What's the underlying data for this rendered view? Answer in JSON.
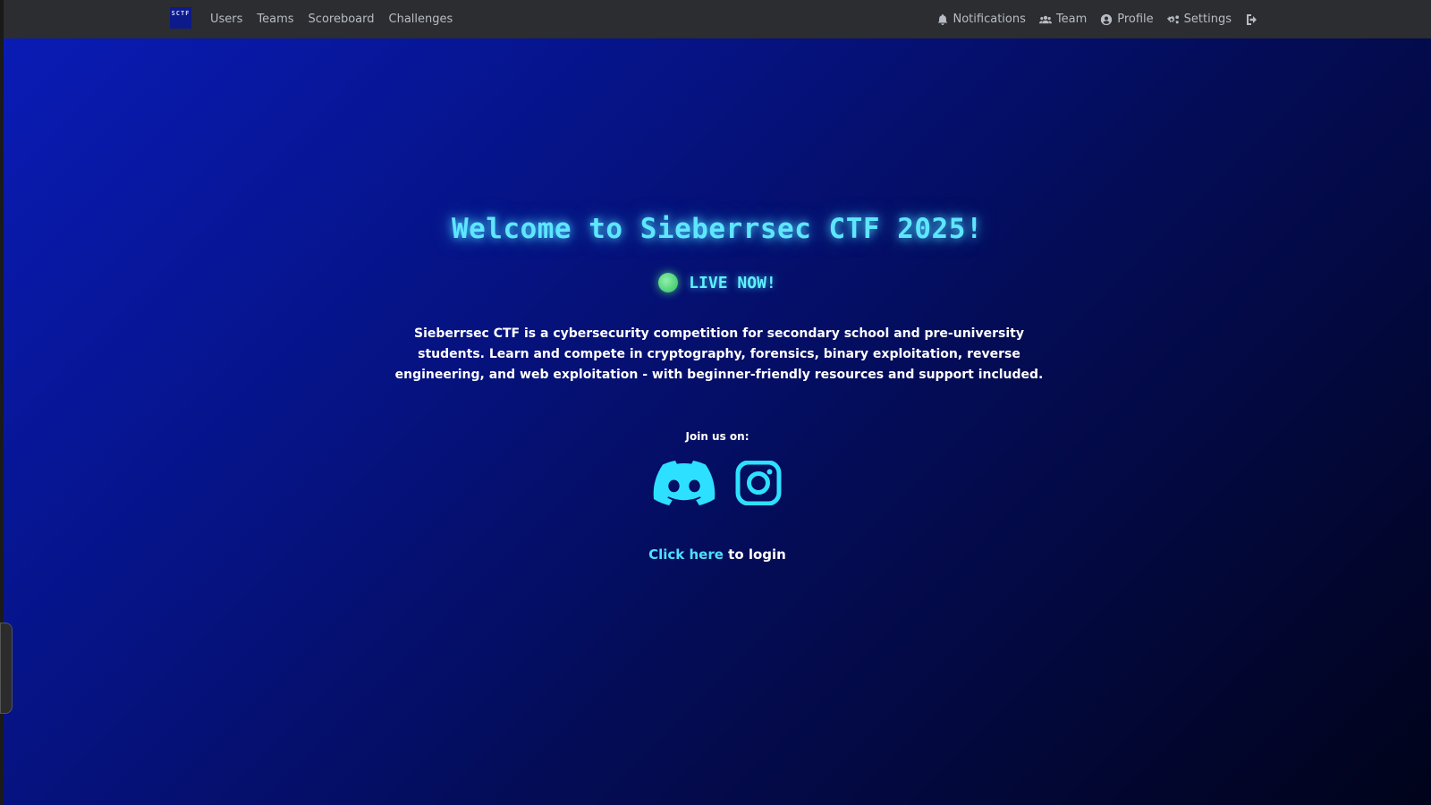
{
  "navbar": {
    "brand": "SCTF",
    "left_links": [
      "Users",
      "Teams",
      "Scoreboard",
      "Challenges"
    ],
    "right_links": [
      {
        "label": "Notifications",
        "icon": "bell-icon"
      },
      {
        "label": "Team",
        "icon": "users-icon"
      },
      {
        "label": "Profile",
        "icon": "user-circle-icon"
      },
      {
        "label": "Settings",
        "icon": "gears-icon"
      }
    ],
    "logout_icon": "sign-out-icon"
  },
  "hero": {
    "title": "Welcome to Sieberrsec CTF 2025!",
    "live_label": "LIVE NOW!",
    "description": "Sieberrsec CTF is a cybersecurity competition for secondary school and pre-university students. Learn and compete in cryptography, forensics, binary exploitation, reverse engineering, and web exploitation - with beginner-friendly resources and support included.",
    "join_label": "Join us on:",
    "socials": [
      "discord-icon",
      "instagram-icon"
    ],
    "login_link": "Click here",
    "login_suffix": " to login"
  },
  "colors": {
    "navbar_bg": "#2b2d30",
    "accent_cyan": "#5ee6ff",
    "live_green": "#2fbf5f"
  }
}
